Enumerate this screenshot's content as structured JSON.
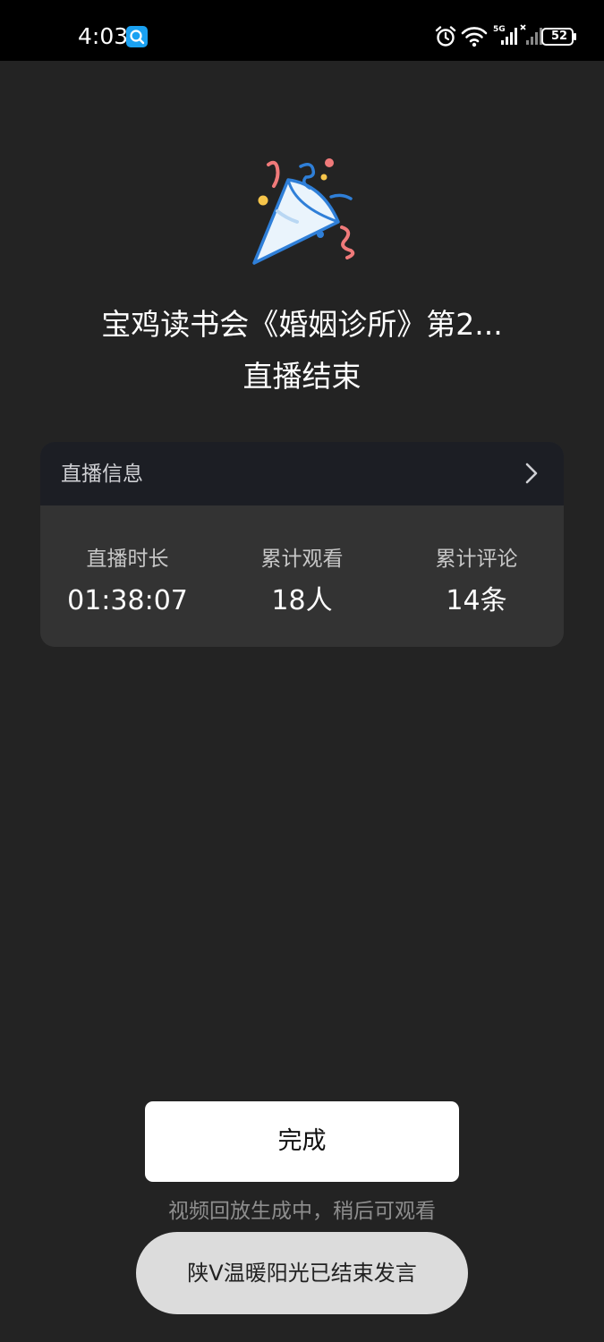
{
  "status_bar": {
    "time": "4:03",
    "battery": "52",
    "network": "5G"
  },
  "summary": {
    "title": "宝鸡读书会《婚姻诊所》第2...",
    "subtitle": "直播结束"
  },
  "info_card": {
    "header_label": "直播信息",
    "stats": [
      {
        "label": "直播时长",
        "value": "01:38:07"
      },
      {
        "label": "累计观看",
        "value": "18人"
      },
      {
        "label": "累计评论",
        "value": "14条"
      }
    ]
  },
  "actions": {
    "done_label": "完成",
    "replay_note": "视频回放生成中，稍后可观看"
  },
  "toast": {
    "message": "陕V温暖阳光已结束发言"
  }
}
